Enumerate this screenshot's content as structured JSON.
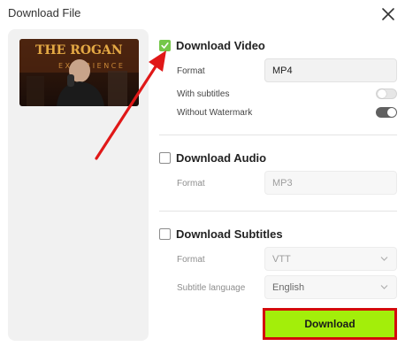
{
  "dialog": {
    "title": "Download File"
  },
  "video": {
    "checked": true,
    "label": "Download Video",
    "format_label": "Format",
    "format_value": "MP4",
    "subtitles_label": "With subtitles",
    "subtitles_on": false,
    "watermark_label": "Without Watermark",
    "watermark_on": true
  },
  "audio": {
    "checked": false,
    "label": "Download Audio",
    "format_label": "Format",
    "format_value": "MP3"
  },
  "subtitles": {
    "checked": false,
    "label": "Download Subtitles",
    "format_label": "Format",
    "format_value": "VTT",
    "language_label": "Subtitle language",
    "language_value": "English"
  },
  "download_label": "Download",
  "colors": {
    "accent": "#a3ee0a",
    "check_green": "#75c74a",
    "highlight_red": "#d40b0b"
  }
}
